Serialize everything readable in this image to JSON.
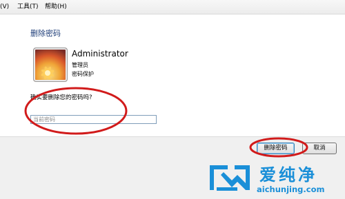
{
  "menubar": {
    "items": [
      "(V)",
      "工具(T)",
      "帮助(H)"
    ]
  },
  "page": {
    "heading": "删除密码"
  },
  "account": {
    "name": "Administrator",
    "role": "管理员",
    "protection": "密码保护"
  },
  "prompt": {
    "question": "确实要删除您的密码吗?",
    "password_placeholder": "当前密码",
    "password_value": ""
  },
  "buttons": {
    "delete": "删除密码",
    "cancel": "取消"
  },
  "watermark": {
    "title": "爱纯净",
    "url": "aichunjing.com",
    "color": "#1a8fd8"
  },
  "colors": {
    "annotation": "#d11b1b",
    "heading": "#1e3d78"
  }
}
